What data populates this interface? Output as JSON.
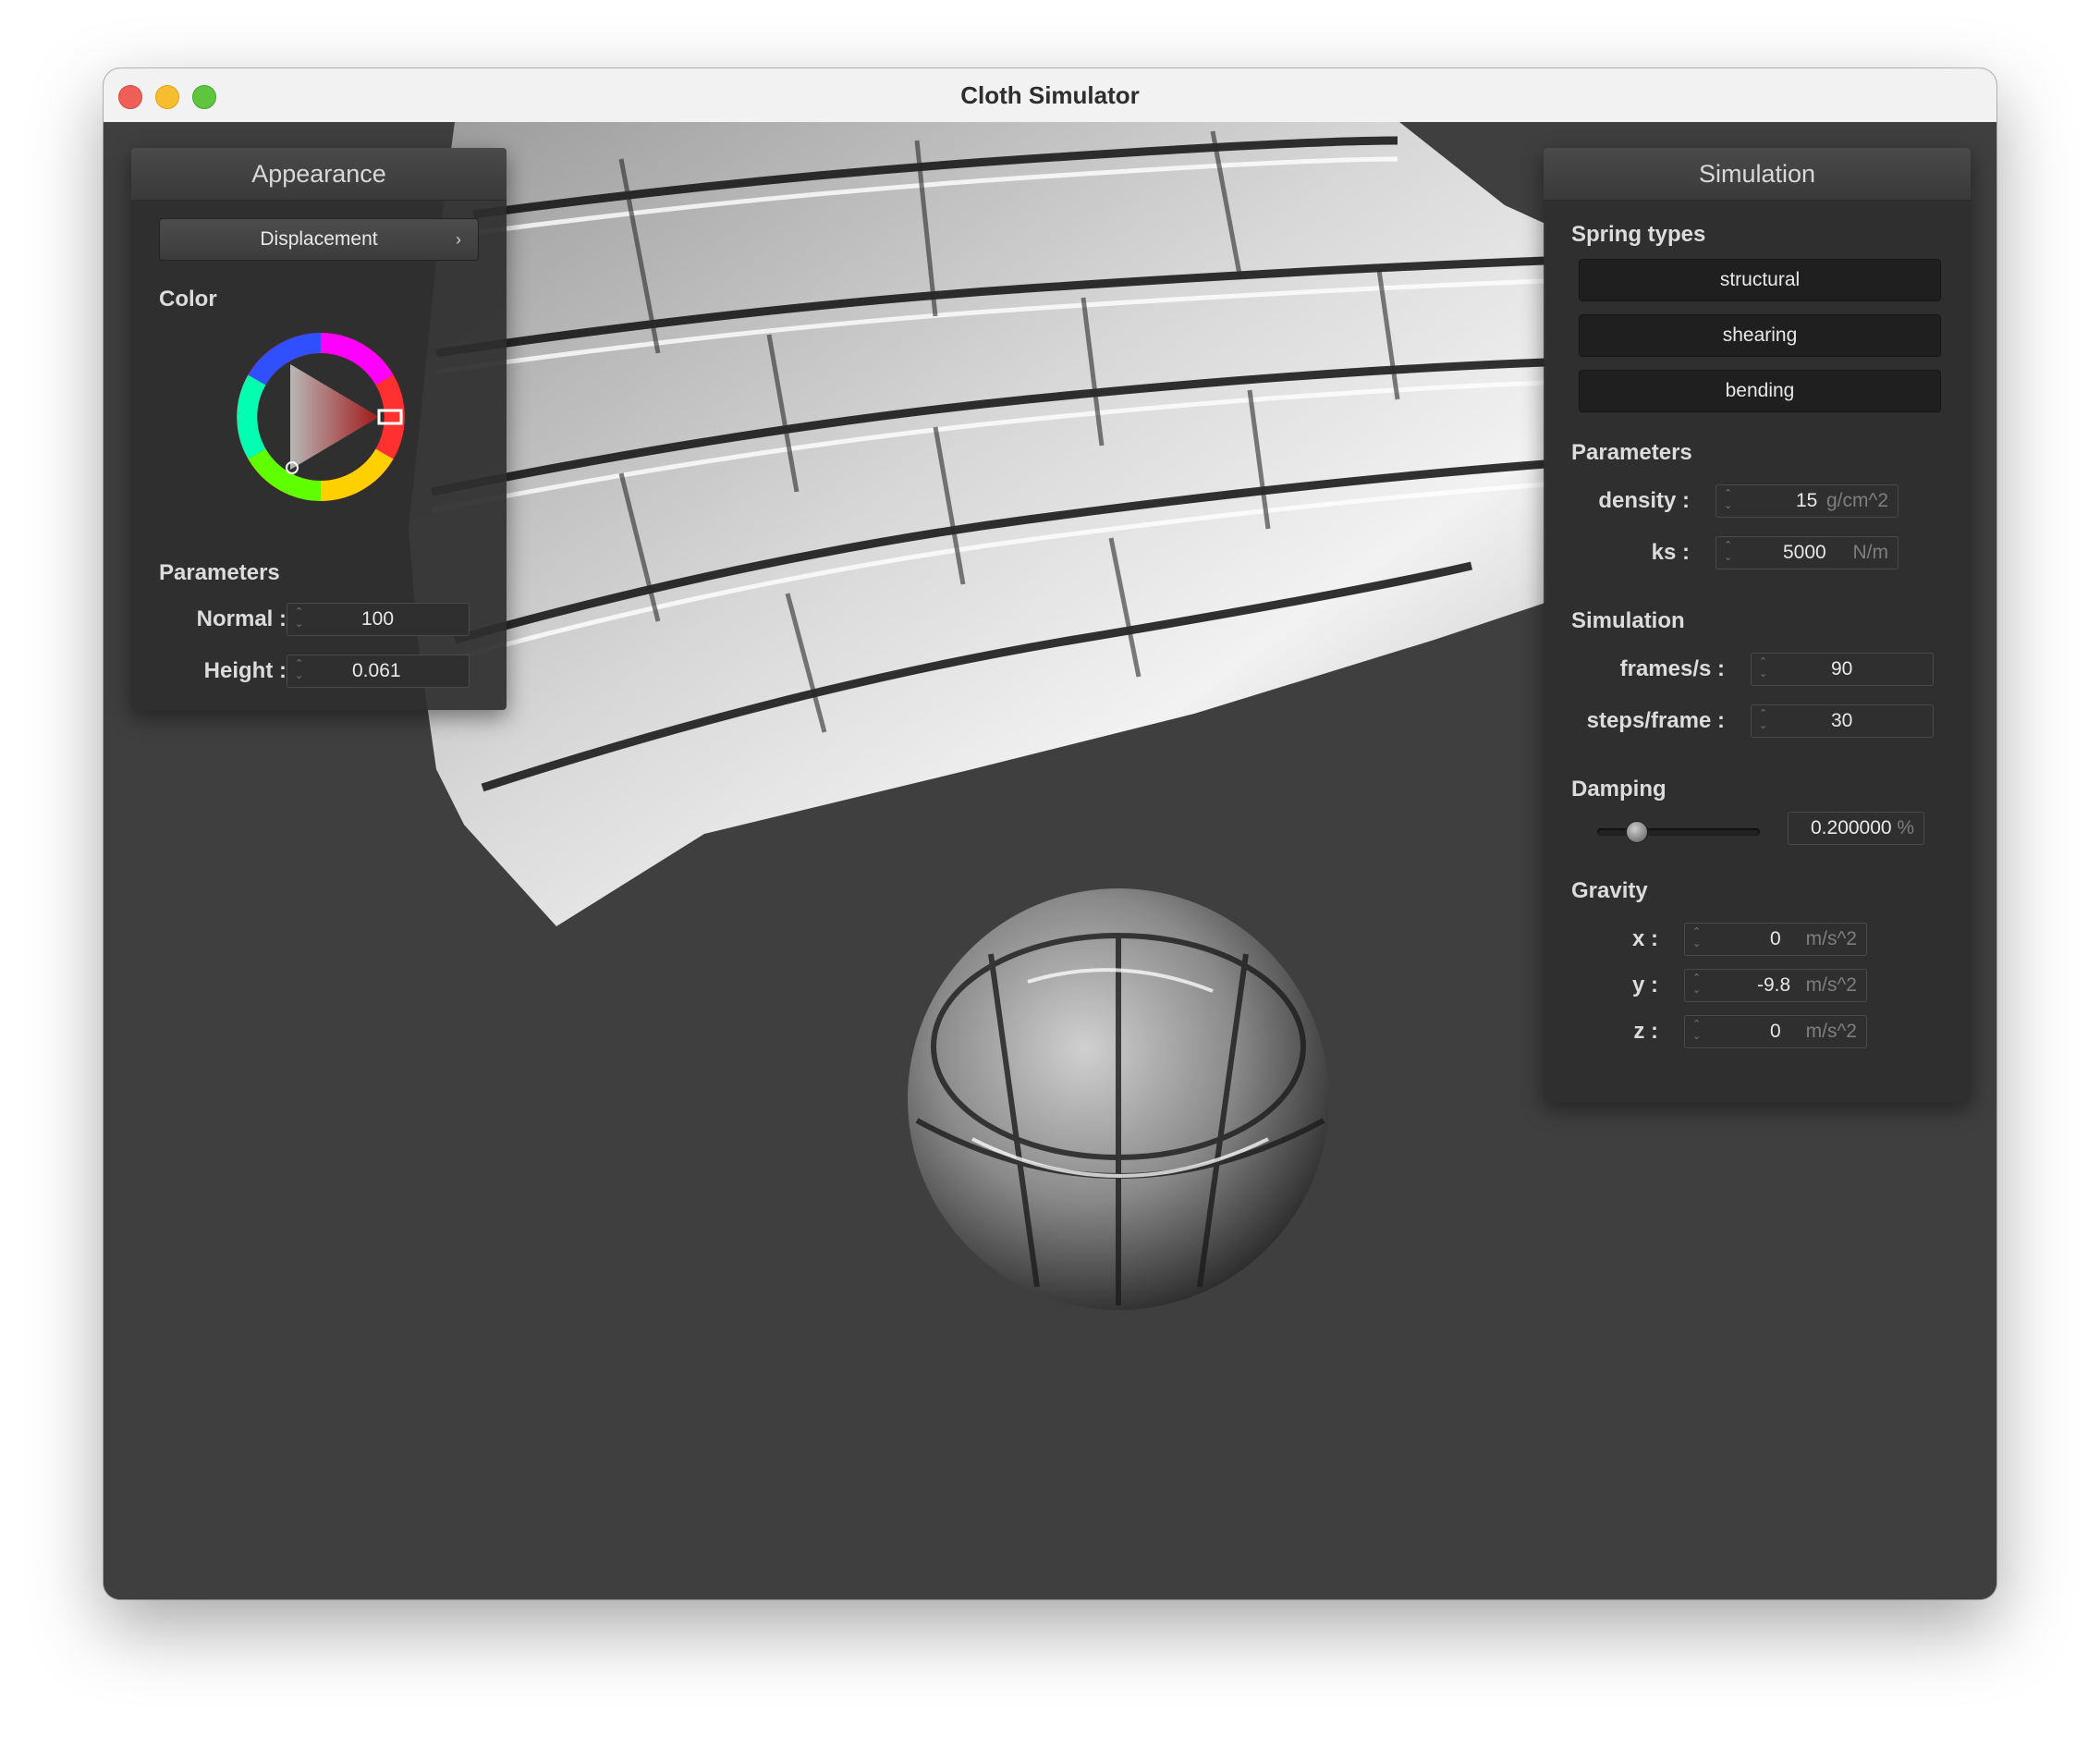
{
  "window": {
    "title": "Cloth Simulator"
  },
  "appearance": {
    "header": "Appearance",
    "shader_dropdown": "Displacement",
    "color_label": "Color",
    "parameters_label": "Parameters",
    "color_selected": "#e03030",
    "fields": [
      {
        "label": "Normal :",
        "value": "100"
      },
      {
        "label": "Height :",
        "value": "0.061"
      }
    ]
  },
  "simulation": {
    "header": "Simulation",
    "spring_types_label": "Spring types",
    "spring_types": [
      "structural",
      "shearing",
      "bending"
    ],
    "parameters_label": "Parameters",
    "parameters": [
      {
        "label": "density :",
        "value": "15",
        "unit": "g/cm^2"
      },
      {
        "label": "ks :",
        "value": "5000",
        "unit": "N/m"
      }
    ],
    "simulation_label": "Simulation",
    "sim_fields": [
      {
        "label": "frames/s :",
        "value": "90"
      },
      {
        "label": "steps/frame :",
        "value": "30"
      }
    ],
    "damping_label": "Damping",
    "damping_value": "0.200000",
    "damping_unit": "%",
    "damping_level": 0.2,
    "gravity_label": "Gravity",
    "gravity": [
      {
        "label": "x :",
        "value": "0",
        "unit": "m/s^2"
      },
      {
        "label": "y :",
        "value": "-9.8",
        "unit": "m/s^2"
      },
      {
        "label": "z :",
        "value": "0",
        "unit": "m/s^2"
      }
    ]
  },
  "icons": {
    "close": "close-traffic-light",
    "minimize": "minimize-traffic-light",
    "maximize": "maximize-traffic-light",
    "dropdown": "chevron-right-icon",
    "spinner": "up-down-arrows-icon"
  }
}
